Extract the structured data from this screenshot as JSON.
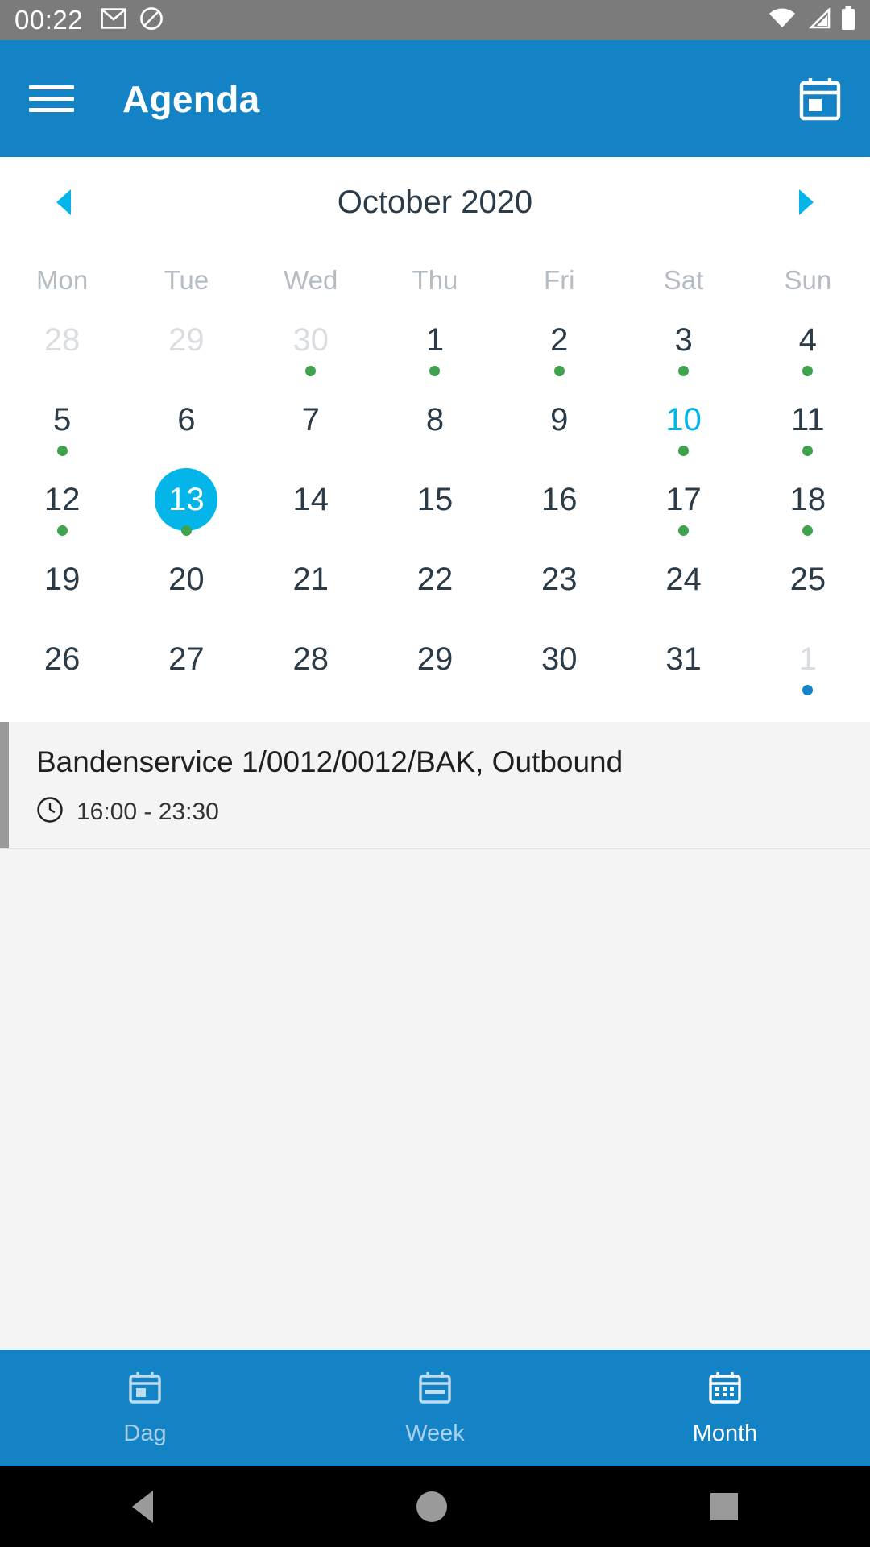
{
  "status_bar": {
    "clock": "00:22",
    "left_icons": [
      "gmail-icon",
      "do-not-disturb-icon"
    ],
    "right_icons": [
      "wifi-icon",
      "cellular-signal-icon",
      "battery-icon"
    ]
  },
  "app_bar": {
    "menu_icon": "hamburger-menu-icon",
    "title": "Agenda",
    "action_icon": "calendar-icon"
  },
  "month_header": {
    "prev_label": "◀",
    "label": "October 2020",
    "next_label": "▶"
  },
  "weekdays": [
    "Mon",
    "Tue",
    "Wed",
    "Thu",
    "Fri",
    "Sat",
    "Sun"
  ],
  "colors": {
    "app_bar": "#1383c6",
    "accent_cyan": "#03b5e8",
    "event_dot_green": "#3fa34d",
    "event_dot_blue": "#1383c6",
    "status_bar": "#7b7b7b",
    "date_text": "#2b3b47",
    "muted_date_text": "#dadee2",
    "weekday_text": "#b6bcc4",
    "event_card_bg": "#f4f4f4",
    "event_accent_bar": "#9a9a9a"
  },
  "days": [
    {
      "num": "28",
      "state": "other-month",
      "dot": "none"
    },
    {
      "num": "29",
      "state": "other-month",
      "dot": "none"
    },
    {
      "num": "30",
      "state": "other-month",
      "dot": "green"
    },
    {
      "num": "1",
      "state": "normal",
      "dot": "green"
    },
    {
      "num": "2",
      "state": "normal",
      "dot": "green"
    },
    {
      "num": "3",
      "state": "normal",
      "dot": "green"
    },
    {
      "num": "4",
      "state": "normal",
      "dot": "green"
    },
    {
      "num": "5",
      "state": "normal",
      "dot": "green"
    },
    {
      "num": "6",
      "state": "normal",
      "dot": "none"
    },
    {
      "num": "7",
      "state": "normal",
      "dot": "none"
    },
    {
      "num": "8",
      "state": "normal",
      "dot": "none"
    },
    {
      "num": "9",
      "state": "normal",
      "dot": "none"
    },
    {
      "num": "10",
      "state": "today",
      "dot": "green"
    },
    {
      "num": "11",
      "state": "normal",
      "dot": "green"
    },
    {
      "num": "12",
      "state": "normal",
      "dot": "green"
    },
    {
      "num": "13",
      "state": "selected",
      "dot": "green"
    },
    {
      "num": "14",
      "state": "normal",
      "dot": "none"
    },
    {
      "num": "15",
      "state": "normal",
      "dot": "none"
    },
    {
      "num": "16",
      "state": "normal",
      "dot": "none"
    },
    {
      "num": "17",
      "state": "normal",
      "dot": "green"
    },
    {
      "num": "18",
      "state": "normal",
      "dot": "green"
    },
    {
      "num": "19",
      "state": "normal",
      "dot": "none"
    },
    {
      "num": "20",
      "state": "normal",
      "dot": "none"
    },
    {
      "num": "21",
      "state": "normal",
      "dot": "none"
    },
    {
      "num": "22",
      "state": "normal",
      "dot": "none"
    },
    {
      "num": "23",
      "state": "normal",
      "dot": "none"
    },
    {
      "num": "24",
      "state": "normal",
      "dot": "none"
    },
    {
      "num": "25",
      "state": "normal",
      "dot": "none"
    },
    {
      "num": "26",
      "state": "normal",
      "dot": "none"
    },
    {
      "num": "27",
      "state": "normal",
      "dot": "none"
    },
    {
      "num": "28",
      "state": "normal",
      "dot": "none"
    },
    {
      "num": "29",
      "state": "normal",
      "dot": "none"
    },
    {
      "num": "30",
      "state": "normal",
      "dot": "none"
    },
    {
      "num": "31",
      "state": "normal",
      "dot": "none"
    },
    {
      "num": "1",
      "state": "other-month",
      "dot": "blue"
    }
  ],
  "events": [
    {
      "title": "Bandenservice 1/0012/0012/BAK, Outbound",
      "time_icon": "clock-icon",
      "time": "16:00 - 23:30"
    }
  ],
  "bottom_nav": [
    {
      "label": "Dag",
      "icon": "calendar-day-icon",
      "active": false
    },
    {
      "label": "Week",
      "icon": "calendar-week-icon",
      "active": false
    },
    {
      "label": "Month",
      "icon": "calendar-month-icon",
      "active": true
    }
  ],
  "android_nav": {
    "back": "back-triangle-icon",
    "home": "home-circle-icon",
    "recents": "recents-square-icon"
  }
}
